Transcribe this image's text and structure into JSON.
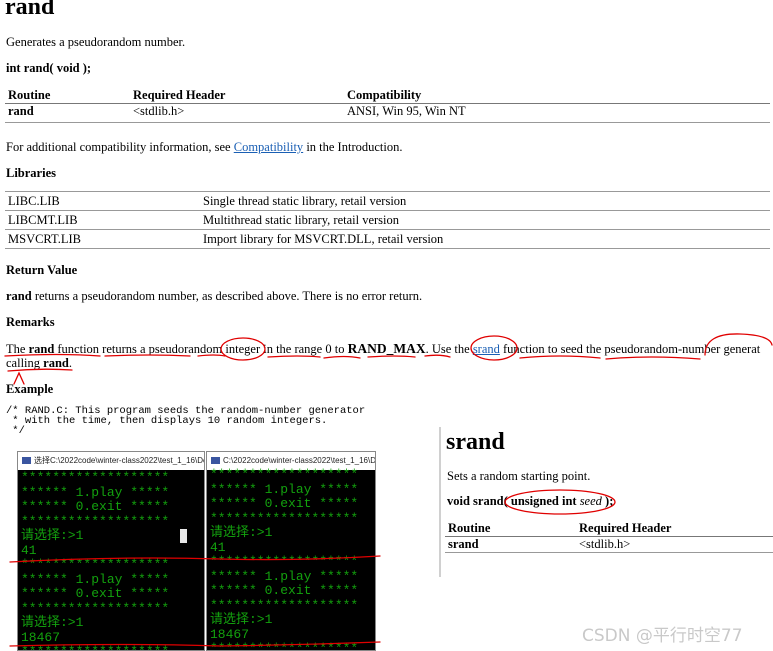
{
  "rand_doc": {
    "title": "rand",
    "summary": "Generates a pseudorandom number.",
    "signature": "int rand( void );",
    "header_table": {
      "columns": [
        "Routine",
        "Required Header",
        "Compatibility"
      ],
      "row": [
        "rand",
        "<stdlib.h>",
        "ANSI, Win 95, Win NT"
      ]
    },
    "compat_prefix": "For additional compatibility information, see ",
    "compat_link": "Compatibility",
    "compat_suffix": " in the Introduction.",
    "libraries_heading": "Libraries",
    "libraries": [
      [
        "LIBC.LIB",
        "Single thread static library, retail version"
      ],
      [
        "LIBCMT.LIB",
        "Multithread static library, retail version"
      ],
      [
        "MSVCRT.LIB",
        "Import library for MSVCRT.DLL, retail version"
      ]
    ],
    "return_heading": "Return Value",
    "return_bold": "rand",
    "return_text": " returns a pseudorandom number, as described above. There is no error return.",
    "remarks_heading": "Remarks",
    "remarks": {
      "t1": "The ",
      "b1": "rand",
      "t2": " function returns a pseudorandom integer in the range 0 to ",
      "b2": "RAND_MAX",
      "t3": ". Use the ",
      "link": "srand",
      "t4": " function to seed the pseudorandom-number generat",
      "t5": "calling ",
      "b3": "rand",
      "t6": "."
    },
    "example_heading": "Example",
    "code": "/* RAND.C: This program seeds the random-number generator\n * with the time, then displays 10 random integers.\n */"
  },
  "srand_doc": {
    "title": "srand",
    "summary": "Sets a random starting point.",
    "sig_prefix": "void srand( ",
    "sig_type": "unsigned int",
    "sig_param": " seed",
    "sig_suffix": " );",
    "columns": [
      "Routine",
      "Required Header"
    ],
    "row": [
      "srand",
      "<stdlib.h>"
    ]
  },
  "console_left": {
    "title": "选择C:\\2022code\\winter-class2022\\test_1_16\\De",
    "lines": [
      "*******************",
      "****** 1.play *****",
      "****** 0.exit *****",
      "*******************",
      "请选择:>1",
      "41",
      "*******************",
      "****** 1.play *****",
      "****** 0.exit *****",
      "*******************",
      "请选择:>1",
      "18467",
      "*******************"
    ]
  },
  "console_right": {
    "title": "C:\\2022code\\winter-class2022\\test_1_16\\D",
    "lines": [
      "*******************",
      "****** 1.play *****",
      "****** 0.exit *****",
      "*******************",
      "请选择:>1",
      "41",
      "*******************",
      "****** 1.play *****",
      "****** 0.exit *****",
      "*******************",
      "请选择:>1",
      "18467",
      "*******************"
    ]
  },
  "watermark": "CSDN @平行时空77",
  "colors": {
    "console_bg": "#000000",
    "console_text": "#13a10e",
    "annotation": "#e00000",
    "link": "#1a5fb4"
  }
}
